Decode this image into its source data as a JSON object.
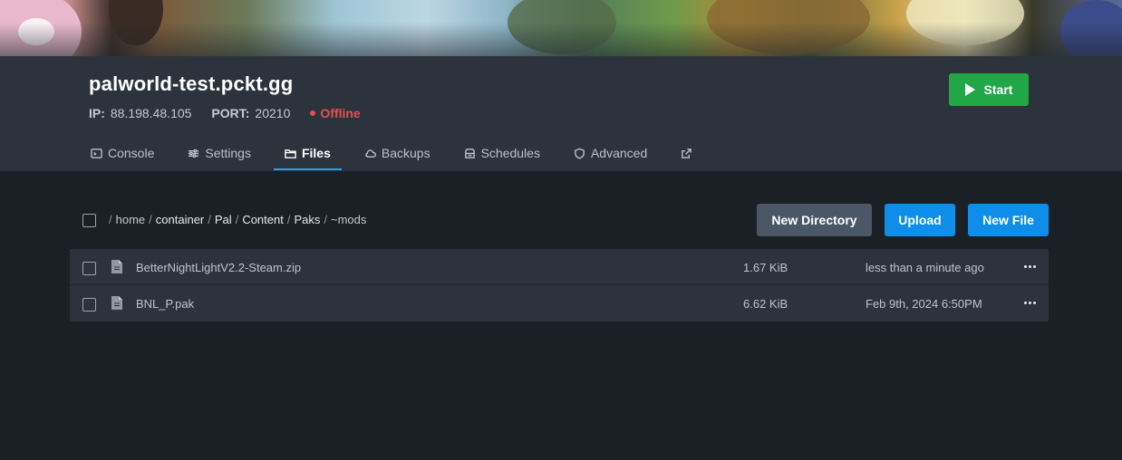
{
  "server": {
    "title": "palworld-test.pckt.gg",
    "ip_label": "IP:",
    "ip_value": "88.198.48.105",
    "port_label": "PORT:",
    "port_value": "20210",
    "status": "Offline",
    "start_label": "Start"
  },
  "tabs": [
    {
      "label": "Console",
      "icon": "terminal-icon"
    },
    {
      "label": "Settings",
      "icon": "sliders-icon"
    },
    {
      "label": "Files",
      "icon": "folder-icon",
      "active": true
    },
    {
      "label": "Backups",
      "icon": "cloud-icon"
    },
    {
      "label": "Schedules",
      "icon": "archive-icon"
    },
    {
      "label": "Advanced",
      "icon": "shield-icon"
    },
    {
      "label": "",
      "icon": "external-link-icon"
    }
  ],
  "breadcrumb": {
    "sep": "/",
    "root": "home",
    "segments": [
      "container",
      "Pal",
      "Content",
      "Paks",
      "~mods"
    ]
  },
  "actions": {
    "new_directory": "New Directory",
    "upload": "Upload",
    "new_file": "New File"
  },
  "files": [
    {
      "name": "BetterNightLightV2.2-Steam.zip",
      "size": "1.67 KiB",
      "modified": "less than a minute ago"
    },
    {
      "name": "BNL_P.pak",
      "size": "6.62 KiB",
      "modified": "Feb 9th, 2024 6:50PM"
    }
  ],
  "colors": {
    "accent": "#0e8ee8",
    "start": "#22a748",
    "offline": "#e05252",
    "tab_underline": "#2f9be8"
  }
}
